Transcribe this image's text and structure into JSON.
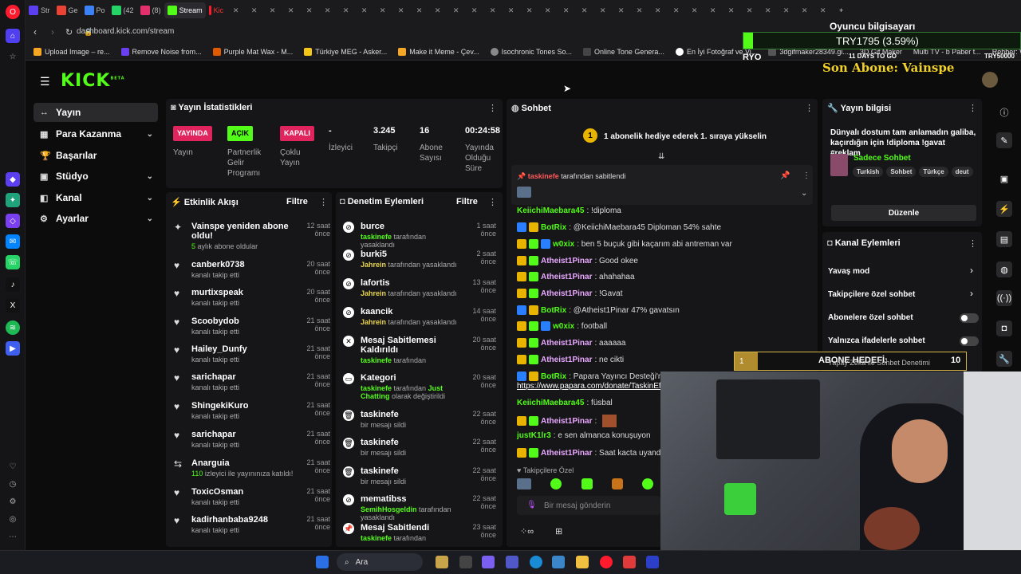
{
  "browser": {
    "tabs": [
      "Str",
      "Ge",
      "Po",
      "(42",
      "(8)",
      "Stream",
      "Kic"
    ],
    "url": "dashboard.kick.com/stream",
    "bookmarks": [
      "Upload Image – re...",
      "Remove Noise from...",
      "Purple Mat Wax - M...",
      "Türkiye MEG - Asker...",
      "Make it Meme - Çev...",
      "Isochronic Tones So...",
      "Online Tone Genera...",
      "En İyi Fotoğraf ve Vi...",
      "3dgifmaker28349.gi...",
      "3D Gif Maker",
      "Multi TV - b Paber t...",
      "Rehber: Windows 1..."
    ]
  },
  "app": {
    "logo": "KICK",
    "logo_beta": "BETA",
    "sidebar": [
      {
        "label": "Yayın",
        "icon": "↔"
      },
      {
        "label": "Para Kazanma",
        "icon": "▦"
      },
      {
        "label": "Başarılar",
        "icon": "🏆"
      },
      {
        "label": "Stüdyo",
        "icon": "▣"
      },
      {
        "label": "Kanal",
        "icon": "◧"
      },
      {
        "label": "Ayarlar",
        "icon": "⚙"
      }
    ]
  },
  "stats": {
    "title": "Yayın İstatistikleri",
    "live_badge": "YAYINDA",
    "live_label": "Yayın",
    "partner_badge": "AÇIK",
    "partner_label": "Partnerlik Gelir Programı",
    "multi_badge": "KAPALI",
    "multi_label": "Çoklu Yayın",
    "viewers_val": "-",
    "viewers_label": "İzleyici",
    "followers_val": "3.245",
    "followers_label": "Takipçi",
    "subs_val": "16",
    "subs_label": "Abone Sayısı",
    "uptime_val": "00:24:58",
    "uptime_label": "Yayında Olduğu Süre"
  },
  "activity": {
    "title": "Etkinlik Akışı",
    "filter": "Filtre",
    "items": [
      {
        "title": "Vainspe yeniden abone oldu!",
        "sub_hl": "5",
        "sub": " aylık abone oldular",
        "time": "12 saat önce",
        "icon": "✦"
      },
      {
        "title": "canberk0738",
        "sub": "kanalı takip etti",
        "time": "20 saat önce",
        "icon": "♥"
      },
      {
        "title": "murtixspeak",
        "sub": "kanalı takip etti",
        "time": "20 saat önce",
        "icon": "♥"
      },
      {
        "title": "Scoobydob",
        "sub": "kanalı takip etti",
        "time": "21 saat önce",
        "icon": "♥"
      },
      {
        "title": "Hailey_Dunfy",
        "sub": "kanalı takip etti",
        "time": "21 saat önce",
        "icon": "♥"
      },
      {
        "title": "sarichapar",
        "sub": "kanalı takip etti",
        "time": "21 saat önce",
        "icon": "♥"
      },
      {
        "title": "ShingekiKuro",
        "sub": "kanalı takip etti",
        "time": "21 saat önce",
        "icon": "♥"
      },
      {
        "title": "sarichapar",
        "sub": "kanalı takip etti",
        "time": "21 saat önce",
        "icon": "♥"
      },
      {
        "title": "Anarguia",
        "sub_hl": "110",
        "sub": " izleyici ile yayınınıza katıldı!",
        "time": "21 saat önce",
        "icon": "⇆"
      },
      {
        "title": "ToxicOsman",
        "sub": "kanalı takip etti",
        "time": "21 saat önce",
        "icon": "♥"
      },
      {
        "title": "kadirhanbaba9248",
        "sub": "kanalı takip etti",
        "time": "21 saat önce",
        "icon": "♥"
      }
    ]
  },
  "moderation": {
    "title": "Denetim Eylemleri",
    "filter": "Filtre",
    "items": [
      {
        "title": "burce",
        "by": "taskinefe",
        "action": " tarafından yasaklandı",
        "time": "1 saat önce",
        "icon": "⊘"
      },
      {
        "title": "burki5",
        "by": "Jahrein",
        "action": " tarafından yasaklandı",
        "time": "2 saat önce",
        "icon": "⊘",
        "by_color": "yellow"
      },
      {
        "title": "lafortis",
        "by": "Jahrein",
        "action": " tarafından yasaklandı",
        "time": "13 saat önce",
        "icon": "⊘",
        "by_color": "yellow"
      },
      {
        "title": "kaancik",
        "by": "Jahrein",
        "action": " tarafından yasaklandı",
        "time": "14 saat önce",
        "icon": "⊘",
        "by_color": "yellow"
      },
      {
        "title": "Mesaj Sabitlemesi Kaldırıldı",
        "by": "taskinefe",
        "action": " tarafından",
        "time": "20 saat önce",
        "icon": "✕"
      },
      {
        "title": "Kategori",
        "by": "taskinefe",
        "action": " tarafından ",
        "extra": "Just Chatting",
        "extra2": " olarak değiştirildi",
        "time": "20 saat önce",
        "icon": "▭"
      },
      {
        "title": "taskinefe",
        "by": "",
        "action": "bir mesajı sildi",
        "time": "22 saat önce",
        "icon": "🗑"
      },
      {
        "title": "taskinefe",
        "by": "",
        "action": "bir mesajı sildi",
        "time": "22 saat önce",
        "icon": "🗑"
      },
      {
        "title": "taskinefe",
        "by": "",
        "action": "bir mesajı sildi",
        "time": "22 saat önce",
        "icon": "🗑"
      },
      {
        "title": "mematibss",
        "by": "SemihHosgeldin",
        "action": " tarafından yasaklandı",
        "time": "22 saat önce",
        "icon": "⊘"
      },
      {
        "title": "Mesaj Sabitlendi",
        "by": "taskinefe",
        "action": " tarafından",
        "time": "23 saat önce",
        "icon": "📌"
      }
    ]
  },
  "chat": {
    "title": "Sohbet",
    "gift_num": "1",
    "gift_text": "1 abonelik hediye ederek 1. sıraya yükselin",
    "pinned_by": "taskinefe",
    "pinned_text": " tarafından sabitlendi",
    "messages": [
      {
        "nick": "KeiichiMaebara45",
        "color": "#53fc18",
        "text": ": !diploma",
        "badges": 0
      },
      {
        "nick": "BotRix",
        "color": "#53fc18",
        "text": ": @KeiichiMaebara45 Diploman 54% sahte",
        "badges": 2
      },
      {
        "nick": "w0xix",
        "color": "#53fc18",
        "text": ": ben 5 buçuk gibi kaçarım abi antreman var",
        "badges": 3
      },
      {
        "nick": "Atheist1Pinar",
        "color": "#e8a8ff",
        "text": ": Good okee",
        "badges": 2
      },
      {
        "nick": "Atheist1Pinar",
        "color": "#e8a8ff",
        "text": ": ahahahaa",
        "badges": 2
      },
      {
        "nick": "Atheist1Pinar",
        "color": "#e8a8ff",
        "text": ": !Gavat",
        "badges": 2
      },
      {
        "nick": "BotRix",
        "color": "#53fc18",
        "text": ": @Atheist1Pinar 47% gavatsın",
        "badges": 2
      },
      {
        "nick": "w0xix",
        "color": "#53fc18",
        "text": ": football",
        "badges": 3
      },
      {
        "nick": "Atheist1Pinar",
        "color": "#e8a8ff",
        "text": ": aaaaaa",
        "badges": 2
      },
      {
        "nick": "Atheist1Pinar",
        "color": "#e8a8ff",
        "text": ": ne cikti",
        "badges": 2
      },
      {
        "nick": "BotRix",
        "color": "#53fc18",
        "text": ": Papara Yayıncı Desteği'nden",
        "badges": 2
      },
      {
        "nick": "",
        "color": "#fff",
        "text": "https://www.papara.com/donate/TaskinEfe",
        "badges": 0,
        "link": true
      },
      {
        "nick": "KeiichiMaebara45",
        "color": "#53fc18",
        "text": ": füsbal",
        "badges": 0
      },
      {
        "nick": "Atheist1Pinar",
        "color": "#e8a8ff",
        "text": ":",
        "badges": 2
      },
      {
        "nick": "justK1lr3",
        "color": "#53fc18",
        "text": ": e sen almanca konuşuyon",
        "badges": 0
      },
      {
        "nick": "Atheist1Pinar",
        "color": "#e8a8ff",
        "text": ": Saat kacta uyandin ve",
        "badges": 2
      }
    ],
    "followers_only": "Takipçilere Özel",
    "input_placeholder": "Bir mesaj gönderin"
  },
  "stream_info": {
    "title": "Yayın bilgisi",
    "description": "Dünyalı dostum tam anlamadın galiba, kaçırdığın için !diploma !gavat #reklam",
    "category": "Sadece Sohbet",
    "tags": [
      "Turkish",
      "Sohbet",
      "Türkçe",
      "deut"
    ],
    "edit": "Düzenle"
  },
  "channel_actions": {
    "title": "Kanal Eylemleri",
    "items": [
      "Yavaş mod",
      "Takipçilere özel sohbet",
      "Abonelere özel sohbet",
      "Yalnızca ifadelerle sohbet",
      "Yapay Zeka ile Sohbet Denetimi"
    ]
  },
  "overlay": {
    "player_title": "Oyuncu bilgisayarı",
    "ticker": "TRY1795 (3.59%)",
    "ryo": "RYO",
    "days": "11 DAYS TO GO",
    "try_target": "TRY50000",
    "last_sub": "Son Abone: Vainspe",
    "goal_num": "1",
    "goal_text": "ABONE HEDEFİ:",
    "goal_val": "10"
  },
  "taskbar": {
    "search": "Ara"
  }
}
